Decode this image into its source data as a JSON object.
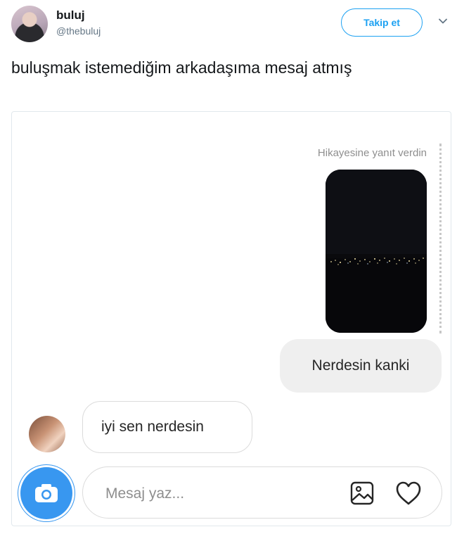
{
  "tweet": {
    "display_name": "buluj",
    "handle": "@thebuluj",
    "follow_label": "Takip et",
    "text": "buluşmak istemediğim arkadaşıma mesaj atmış"
  },
  "chat": {
    "story_reply_label": "Hikayesine yanıt verdin",
    "sent_message": "Nerdesin kanki",
    "received_message": "iyi sen nerdesin",
    "input_placeholder": "Mesaj yaz..."
  },
  "colors": {
    "twitter_blue": "#1da1f2",
    "instagram_blue": "#3897f0",
    "sent_bubble": "#efefef"
  },
  "icons": [
    "chevron-down-icon",
    "camera-icon",
    "gallery-icon",
    "heart-icon"
  ]
}
